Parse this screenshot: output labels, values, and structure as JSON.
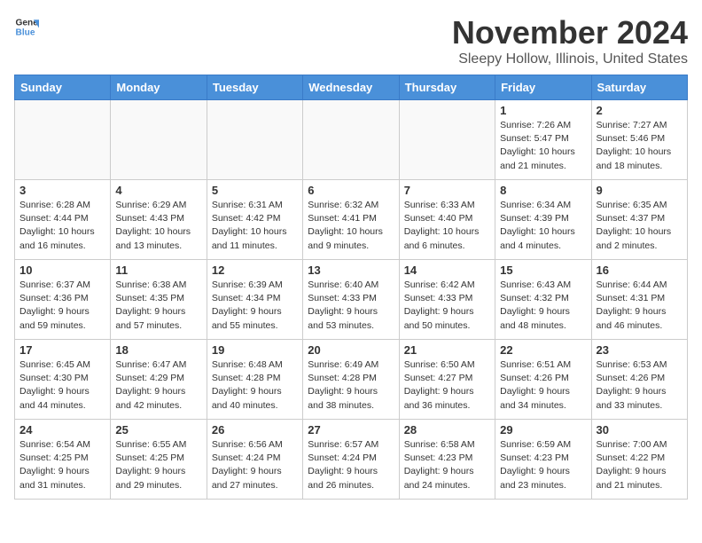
{
  "header": {
    "logo_line1": "General",
    "logo_line2": "Blue",
    "month_title": "November 2024",
    "location": "Sleepy Hollow, Illinois, United States"
  },
  "weekdays": [
    "Sunday",
    "Monday",
    "Tuesday",
    "Wednesday",
    "Thursday",
    "Friday",
    "Saturday"
  ],
  "weeks": [
    [
      {
        "day": "",
        "info": ""
      },
      {
        "day": "",
        "info": ""
      },
      {
        "day": "",
        "info": ""
      },
      {
        "day": "",
        "info": ""
      },
      {
        "day": "",
        "info": ""
      },
      {
        "day": "1",
        "info": "Sunrise: 7:26 AM\nSunset: 5:47 PM\nDaylight: 10 hours and 21 minutes."
      },
      {
        "day": "2",
        "info": "Sunrise: 7:27 AM\nSunset: 5:46 PM\nDaylight: 10 hours and 18 minutes."
      }
    ],
    [
      {
        "day": "3",
        "info": "Sunrise: 6:28 AM\nSunset: 4:44 PM\nDaylight: 10 hours and 16 minutes."
      },
      {
        "day": "4",
        "info": "Sunrise: 6:29 AM\nSunset: 4:43 PM\nDaylight: 10 hours and 13 minutes."
      },
      {
        "day": "5",
        "info": "Sunrise: 6:31 AM\nSunset: 4:42 PM\nDaylight: 10 hours and 11 minutes."
      },
      {
        "day": "6",
        "info": "Sunrise: 6:32 AM\nSunset: 4:41 PM\nDaylight: 10 hours and 9 minutes."
      },
      {
        "day": "7",
        "info": "Sunrise: 6:33 AM\nSunset: 4:40 PM\nDaylight: 10 hours and 6 minutes."
      },
      {
        "day": "8",
        "info": "Sunrise: 6:34 AM\nSunset: 4:39 PM\nDaylight: 10 hours and 4 minutes."
      },
      {
        "day": "9",
        "info": "Sunrise: 6:35 AM\nSunset: 4:37 PM\nDaylight: 10 hours and 2 minutes."
      }
    ],
    [
      {
        "day": "10",
        "info": "Sunrise: 6:37 AM\nSunset: 4:36 PM\nDaylight: 9 hours and 59 minutes."
      },
      {
        "day": "11",
        "info": "Sunrise: 6:38 AM\nSunset: 4:35 PM\nDaylight: 9 hours and 57 minutes."
      },
      {
        "day": "12",
        "info": "Sunrise: 6:39 AM\nSunset: 4:34 PM\nDaylight: 9 hours and 55 minutes."
      },
      {
        "day": "13",
        "info": "Sunrise: 6:40 AM\nSunset: 4:33 PM\nDaylight: 9 hours and 53 minutes."
      },
      {
        "day": "14",
        "info": "Sunrise: 6:42 AM\nSunset: 4:33 PM\nDaylight: 9 hours and 50 minutes."
      },
      {
        "day": "15",
        "info": "Sunrise: 6:43 AM\nSunset: 4:32 PM\nDaylight: 9 hours and 48 minutes."
      },
      {
        "day": "16",
        "info": "Sunrise: 6:44 AM\nSunset: 4:31 PM\nDaylight: 9 hours and 46 minutes."
      }
    ],
    [
      {
        "day": "17",
        "info": "Sunrise: 6:45 AM\nSunset: 4:30 PM\nDaylight: 9 hours and 44 minutes."
      },
      {
        "day": "18",
        "info": "Sunrise: 6:47 AM\nSunset: 4:29 PM\nDaylight: 9 hours and 42 minutes."
      },
      {
        "day": "19",
        "info": "Sunrise: 6:48 AM\nSunset: 4:28 PM\nDaylight: 9 hours and 40 minutes."
      },
      {
        "day": "20",
        "info": "Sunrise: 6:49 AM\nSunset: 4:28 PM\nDaylight: 9 hours and 38 minutes."
      },
      {
        "day": "21",
        "info": "Sunrise: 6:50 AM\nSunset: 4:27 PM\nDaylight: 9 hours and 36 minutes."
      },
      {
        "day": "22",
        "info": "Sunrise: 6:51 AM\nSunset: 4:26 PM\nDaylight: 9 hours and 34 minutes."
      },
      {
        "day": "23",
        "info": "Sunrise: 6:53 AM\nSunset: 4:26 PM\nDaylight: 9 hours and 33 minutes."
      }
    ],
    [
      {
        "day": "24",
        "info": "Sunrise: 6:54 AM\nSunset: 4:25 PM\nDaylight: 9 hours and 31 minutes."
      },
      {
        "day": "25",
        "info": "Sunrise: 6:55 AM\nSunset: 4:25 PM\nDaylight: 9 hours and 29 minutes."
      },
      {
        "day": "26",
        "info": "Sunrise: 6:56 AM\nSunset: 4:24 PM\nDaylight: 9 hours and 27 minutes."
      },
      {
        "day": "27",
        "info": "Sunrise: 6:57 AM\nSunset: 4:24 PM\nDaylight: 9 hours and 26 minutes."
      },
      {
        "day": "28",
        "info": "Sunrise: 6:58 AM\nSunset: 4:23 PM\nDaylight: 9 hours and 24 minutes."
      },
      {
        "day": "29",
        "info": "Sunrise: 6:59 AM\nSunset: 4:23 PM\nDaylight: 9 hours and 23 minutes."
      },
      {
        "day": "30",
        "info": "Sunrise: 7:00 AM\nSunset: 4:22 PM\nDaylight: 9 hours and 21 minutes."
      }
    ]
  ]
}
